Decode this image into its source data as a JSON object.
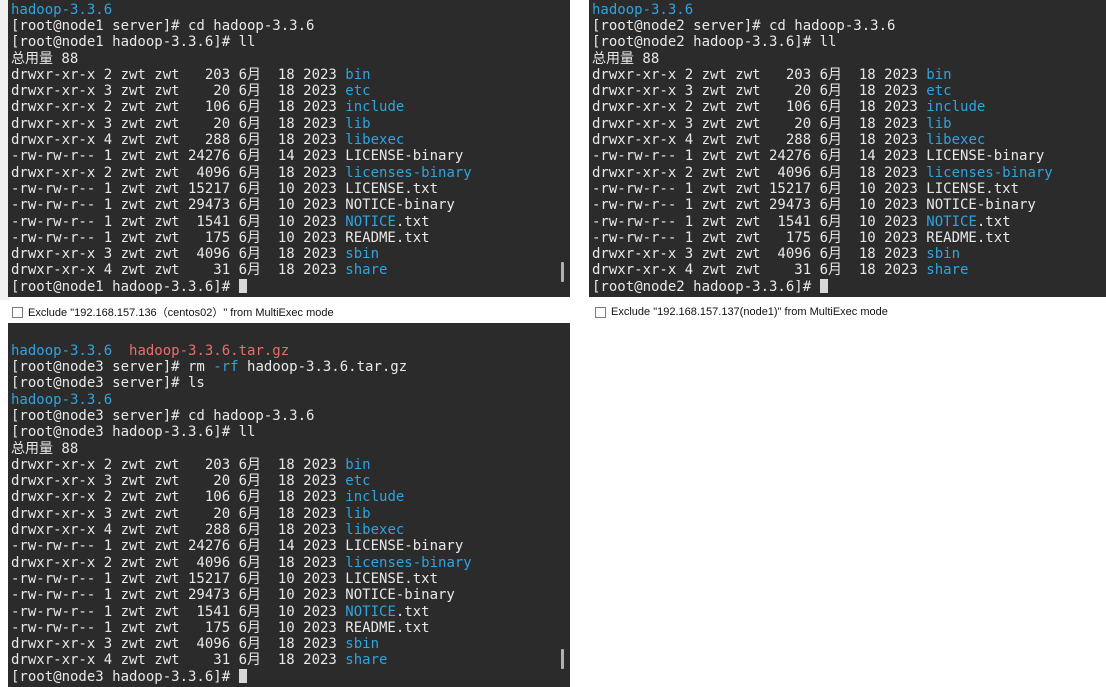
{
  "panes": {
    "node1": {
      "lines": [
        [
          {
            "t": "hadoop-3.3.6",
            "c": "dir"
          }
        ],
        [
          {
            "t": "[root@node1 server]# cd hadoop-3.3.6"
          }
        ],
        [
          {
            "t": "[root@node1 hadoop-3.3.6]# ll"
          }
        ],
        [
          {
            "t": "总用量 88"
          }
        ],
        [
          {
            "t": "drwxr-xr-x 2 zwt zwt   203 6月  18 2023 "
          },
          {
            "t": "bin",
            "c": "dir"
          }
        ],
        [
          {
            "t": "drwxr-xr-x 3 zwt zwt    20 6月  18 2023 "
          },
          {
            "t": "etc",
            "c": "dir"
          }
        ],
        [
          {
            "t": "drwxr-xr-x 2 zwt zwt   106 6月  18 2023 "
          },
          {
            "t": "include",
            "c": "dir"
          }
        ],
        [
          {
            "t": "drwxr-xr-x 3 zwt zwt    20 6月  18 2023 "
          },
          {
            "t": "lib",
            "c": "dir"
          }
        ],
        [
          {
            "t": "drwxr-xr-x 4 zwt zwt   288 6月  18 2023 "
          },
          {
            "t": "libexec",
            "c": "dir"
          }
        ],
        [
          {
            "t": "-rw-rw-r-- 1 zwt zwt 24276 6月  14 2023 LICENSE-binary"
          }
        ],
        [
          {
            "t": "drwxr-xr-x 2 zwt zwt  4096 6月  18 2023 "
          },
          {
            "t": "licenses-binary",
            "c": "dir"
          }
        ],
        [
          {
            "t": "-rw-rw-r-- 1 zwt zwt 15217 6月  10 2023 LICENSE.txt"
          }
        ],
        [
          {
            "t": "-rw-rw-r-- 1 zwt zwt 29473 6月  10 2023 NOTICE-binary"
          }
        ],
        [
          {
            "t": "-rw-rw-r-- 1 zwt zwt  1541 6月  10 2023 "
          },
          {
            "t": "NOTICE",
            "c": "dir"
          },
          {
            "t": ".txt"
          }
        ],
        [
          {
            "t": "-rw-rw-r-- 1 zwt zwt   175 6月  10 2023 README.txt"
          }
        ],
        [
          {
            "t": "drwxr-xr-x 3 zwt zwt  4096 6月  18 2023 "
          },
          {
            "t": "sbin",
            "c": "dir"
          }
        ],
        [
          {
            "t": "drwxr-xr-x 4 zwt zwt    31 6月  18 2023 "
          },
          {
            "t": "share",
            "c": "dir"
          }
        ],
        [
          {
            "t": "[root@node1 hadoop-3.3.6]# "
          },
          {
            "cursor": true
          }
        ]
      ]
    },
    "node2": {
      "lines": [
        [
          {
            "t": "hadoop-3.3.6",
            "c": "dir"
          }
        ],
        [
          {
            "t": "[root@node2 server]# cd hadoop-3.3.6"
          }
        ],
        [
          {
            "t": "[root@node2 hadoop-3.3.6]# ll"
          }
        ],
        [
          {
            "t": "总用量 88"
          }
        ],
        [
          {
            "t": "drwxr-xr-x 2 zwt zwt   203 6月  18 2023 "
          },
          {
            "t": "bin",
            "c": "dir"
          }
        ],
        [
          {
            "t": "drwxr-xr-x 3 zwt zwt    20 6月  18 2023 "
          },
          {
            "t": "etc",
            "c": "dir"
          }
        ],
        [
          {
            "t": "drwxr-xr-x 2 zwt zwt   106 6月  18 2023 "
          },
          {
            "t": "include",
            "c": "dir"
          }
        ],
        [
          {
            "t": "drwxr-xr-x 3 zwt zwt    20 6月  18 2023 "
          },
          {
            "t": "lib",
            "c": "dir"
          }
        ],
        [
          {
            "t": "drwxr-xr-x 4 zwt zwt   288 6月  18 2023 "
          },
          {
            "t": "libexec",
            "c": "dir"
          }
        ],
        [
          {
            "t": "-rw-rw-r-- 1 zwt zwt 24276 6月  14 2023 LICENSE-binary"
          }
        ],
        [
          {
            "t": "drwxr-xr-x 2 zwt zwt  4096 6月  18 2023 "
          },
          {
            "t": "licenses-binary",
            "c": "dir"
          }
        ],
        [
          {
            "t": "-rw-rw-r-- 1 zwt zwt 15217 6月  10 2023 LICENSE.txt"
          }
        ],
        [
          {
            "t": "-rw-rw-r-- 1 zwt zwt 29473 6月  10 2023 NOTICE-binary"
          }
        ],
        [
          {
            "t": "-rw-rw-r-- 1 zwt zwt  1541 6月  10 2023 "
          },
          {
            "t": "NOTICE",
            "c": "dir"
          },
          {
            "t": ".txt"
          }
        ],
        [
          {
            "t": "-rw-rw-r-- 1 zwt zwt   175 6月  10 2023 README.txt"
          }
        ],
        [
          {
            "t": "drwxr-xr-x 3 zwt zwt  4096 6月  18 2023 "
          },
          {
            "t": "sbin",
            "c": "dir"
          }
        ],
        [
          {
            "t": "drwxr-xr-x 4 zwt zwt    31 6月  18 2023 "
          },
          {
            "t": "share",
            "c": "dir"
          }
        ],
        [
          {
            "t": "[root@node2 hadoop-3.3.6]# "
          },
          {
            "cursor": true
          }
        ]
      ]
    },
    "node3": {
      "lines": [
        [
          {
            "t": "hadoop-3.3.6",
            "c": "dir"
          },
          {
            "t": "  "
          },
          {
            "t": "hadoop-3.3.6.tar.gz",
            "c": "arch"
          }
        ],
        [
          {
            "t": "[root@node3 server]# rm "
          },
          {
            "t": "-rf",
            "c": "flag"
          },
          {
            "t": " hadoop-3.3.6.tar.gz"
          }
        ],
        [
          {
            "t": "[root@node3 server]# ls"
          }
        ],
        [
          {
            "t": "hadoop-3.3.6",
            "c": "dir"
          }
        ],
        [
          {
            "t": "[root@node3 server]# cd hadoop-3.3.6"
          }
        ],
        [
          {
            "t": "[root@node3 hadoop-3.3.6]# ll"
          }
        ],
        [
          {
            "t": "总用量 88"
          }
        ],
        [
          {
            "t": "drwxr-xr-x 2 zwt zwt   203 6月  18 2023 "
          },
          {
            "t": "bin",
            "c": "dir"
          }
        ],
        [
          {
            "t": "drwxr-xr-x 3 zwt zwt    20 6月  18 2023 "
          },
          {
            "t": "etc",
            "c": "dir"
          }
        ],
        [
          {
            "t": "drwxr-xr-x 2 zwt zwt   106 6月  18 2023 "
          },
          {
            "t": "include",
            "c": "dir"
          }
        ],
        [
          {
            "t": "drwxr-xr-x 3 zwt zwt    20 6月  18 2023 "
          },
          {
            "t": "lib",
            "c": "dir"
          }
        ],
        [
          {
            "t": "drwxr-xr-x 4 zwt zwt   288 6月  18 2023 "
          },
          {
            "t": "libexec",
            "c": "dir"
          }
        ],
        [
          {
            "t": "-rw-rw-r-- 1 zwt zwt 24276 6月  14 2023 LICENSE-binary"
          }
        ],
        [
          {
            "t": "drwxr-xr-x 2 zwt zwt  4096 6月  18 2023 "
          },
          {
            "t": "licenses-binary",
            "c": "dir"
          }
        ],
        [
          {
            "t": "-rw-rw-r-- 1 zwt zwt 15217 6月  10 2023 LICENSE.txt"
          }
        ],
        [
          {
            "t": "-rw-rw-r-- 1 zwt zwt 29473 6月  10 2023 NOTICE-binary"
          }
        ],
        [
          {
            "t": "-rw-rw-r-- 1 zwt zwt  1541 6月  10 2023 "
          },
          {
            "t": "NOTICE",
            "c": "dir"
          },
          {
            "t": ".txt"
          }
        ],
        [
          {
            "t": "-rw-rw-r-- 1 zwt zwt   175 6月  10 2023 README.txt"
          }
        ],
        [
          {
            "t": "drwxr-xr-x 3 zwt zwt  4096 6月  18 2023 "
          },
          {
            "t": "sbin",
            "c": "dir"
          }
        ],
        [
          {
            "t": "drwxr-xr-x 4 zwt zwt    31 6月  18 2023 "
          },
          {
            "t": "share",
            "c": "dir"
          }
        ],
        [
          {
            "t": "[root@node3 hadoop-3.3.6]# "
          },
          {
            "cursor": true
          }
        ]
      ]
    }
  },
  "exclude": {
    "left": "Exclude \"192.168.157.136（centos02）\" from MultiExec mode",
    "right": "Exclude \"192.168.157.137(node1)\" from MultiExec mode"
  },
  "colors": {
    "terminal_bg": "#2b2b2b",
    "text": "#e8e8e8",
    "directory": "#2fa4e0",
    "archive": "#ef6b6b"
  }
}
